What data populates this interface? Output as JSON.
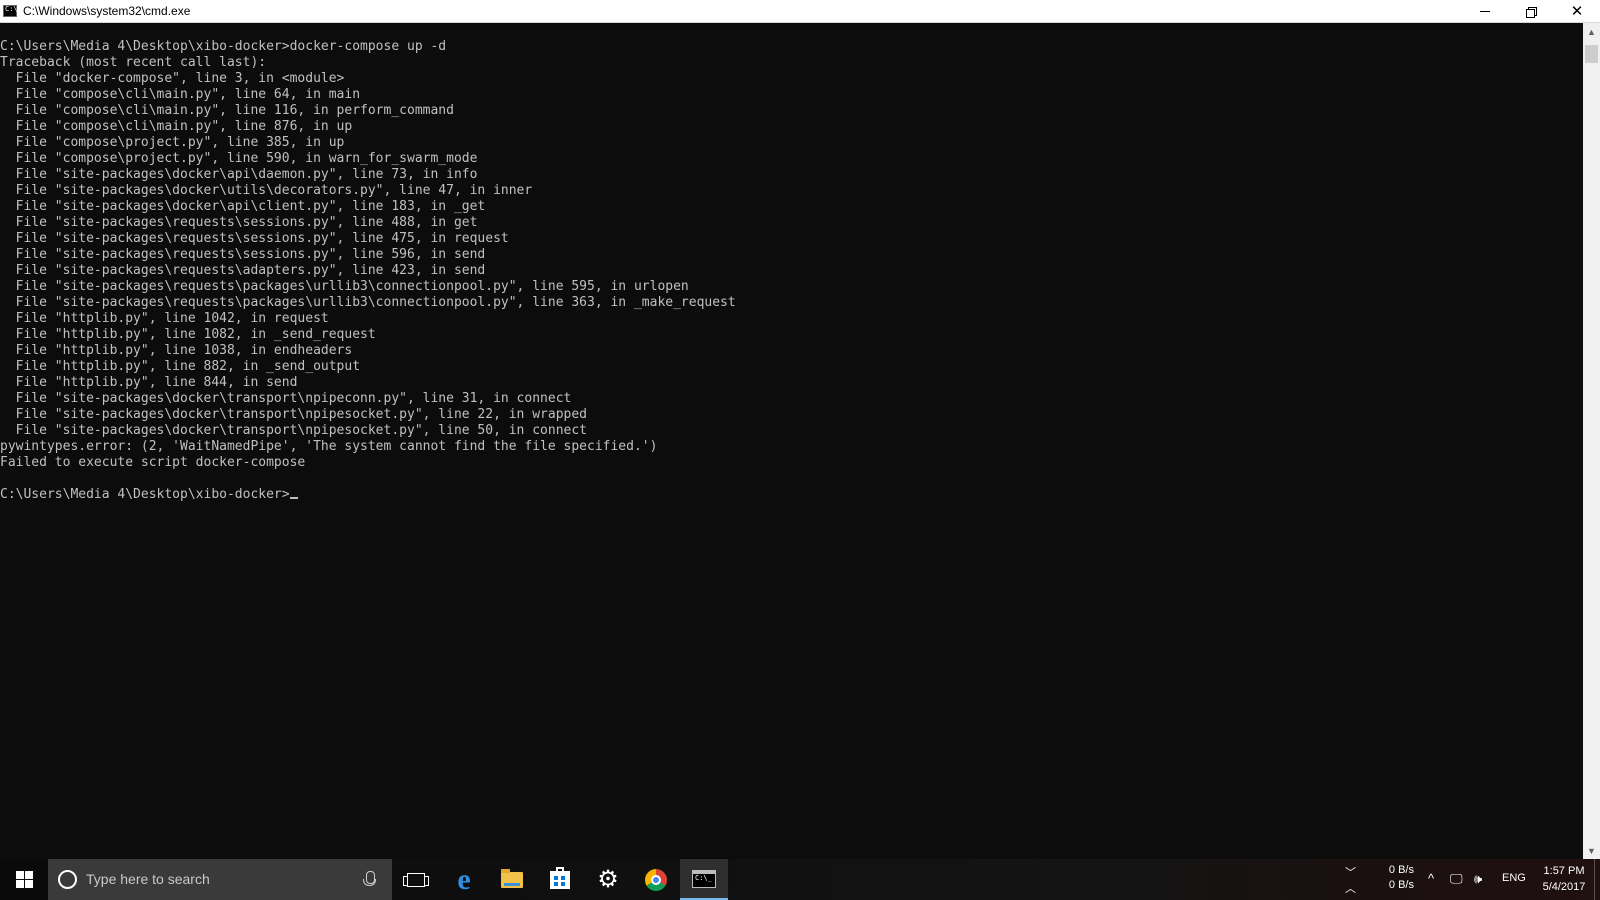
{
  "window": {
    "title": "C:\\Windows\\system32\\cmd.exe",
    "minimize_icon": "minimize-icon",
    "restore_icon": "restore-icon",
    "close_icon": "close-icon"
  },
  "console": {
    "lines": [
      "C:\\Users\\Media 4\\Desktop\\xibo-docker>docker-compose up -d",
      "Traceback (most recent call last):",
      "  File \"docker-compose\", line 3, in <module>",
      "  File \"compose\\cli\\main.py\", line 64, in main",
      "  File \"compose\\cli\\main.py\", line 116, in perform_command",
      "  File \"compose\\cli\\main.py\", line 876, in up",
      "  File \"compose\\project.py\", line 385, in up",
      "  File \"compose\\project.py\", line 590, in warn_for_swarm_mode",
      "  File \"site-packages\\docker\\api\\daemon.py\", line 73, in info",
      "  File \"site-packages\\docker\\utils\\decorators.py\", line 47, in inner",
      "  File \"site-packages\\docker\\api\\client.py\", line 183, in _get",
      "  File \"site-packages\\requests\\sessions.py\", line 488, in get",
      "  File \"site-packages\\requests\\sessions.py\", line 475, in request",
      "  File \"site-packages\\requests\\sessions.py\", line 596, in send",
      "  File \"site-packages\\requests\\adapters.py\", line 423, in send",
      "  File \"site-packages\\requests\\packages\\urllib3\\connectionpool.py\", line 595, in urlopen",
      "  File \"site-packages\\requests\\packages\\urllib3\\connectionpool.py\", line 363, in _make_request",
      "  File \"httplib.py\", line 1042, in request",
      "  File \"httplib.py\", line 1082, in _send_request",
      "  File \"httplib.py\", line 1038, in endheaders",
      "  File \"httplib.py\", line 882, in _send_output",
      "  File \"httplib.py\", line 844, in send",
      "  File \"site-packages\\docker\\transport\\npipeconn.py\", line 31, in connect",
      "  File \"site-packages\\docker\\transport\\npipesocket.py\", line 22, in wrapped",
      "  File \"site-packages\\docker\\transport\\npipesocket.py\", line 50, in connect",
      "pywintypes.error: (2, 'WaitNamedPipe', 'The system cannot find the file specified.')",
      "Failed to execute script docker-compose",
      ""
    ],
    "prompt": "C:\\Users\\Media 4\\Desktop\\xibo-docker>"
  },
  "taskbar": {
    "search_placeholder": "Type here to search",
    "apps": [
      "task-view",
      "edge",
      "file-explorer",
      "store",
      "settings",
      "chrome",
      "cmd"
    ],
    "active_app": "cmd",
    "net_up": "0 B/s",
    "net_down": "0 B/s",
    "language": "ENG",
    "time": "1:57 PM",
    "date": "5/4/2017"
  },
  "colors": {
    "console_bg": "#0c0c0c",
    "console_text": "#c0c0c0",
    "taskbar_bg": "#101010",
    "search_bg": "#3a3a3a",
    "active_indicator": "#76b9ed"
  }
}
